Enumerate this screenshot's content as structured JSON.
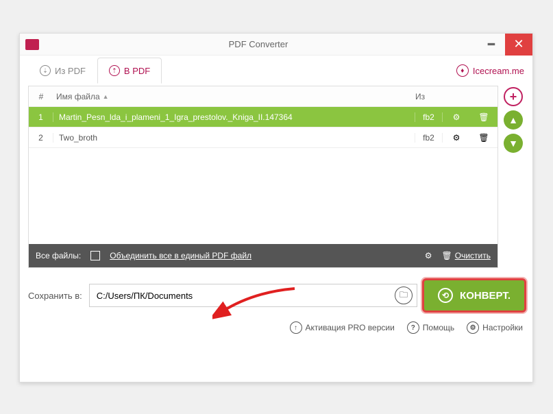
{
  "window": {
    "title": "PDF Converter"
  },
  "tabs": {
    "from_pdf": "Из PDF",
    "to_pdf": "В PDF"
  },
  "brand": {
    "label": "Icecream.me"
  },
  "table": {
    "headers": {
      "num": "#",
      "name": "Имя файла",
      "from": "Из"
    },
    "rows": [
      {
        "num": "1",
        "name": "Martin_Pesn_lda_i_plameni_1_Igra_prestolov._Kniga_II.147364",
        "from": "fb2"
      },
      {
        "num": "2",
        "name": "Two_broth",
        "from": "fb2"
      }
    ]
  },
  "footer": {
    "all_files": "Все файлы:",
    "merge_label": "Объединить все в единый PDF файл",
    "clear": "Очистить"
  },
  "save": {
    "label": "Сохранить в:",
    "path": "C:/Users/ПК/Documents"
  },
  "convert": {
    "label": "КОНВЕРТ."
  },
  "bottom": {
    "pro": "Активация PRO версии",
    "help": "Помощь",
    "settings": "Настройки"
  }
}
